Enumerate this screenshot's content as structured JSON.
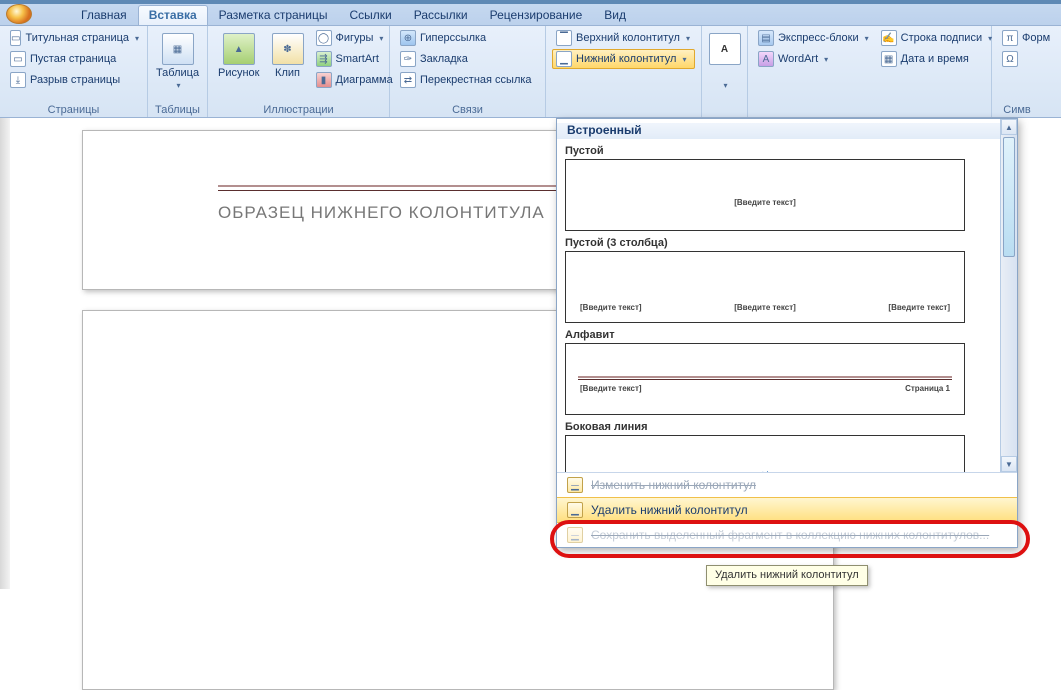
{
  "tabs": {
    "home": "Главная",
    "insert": "Вставка",
    "layout": "Разметка страницы",
    "refs": "Ссылки",
    "mail": "Рассылки",
    "review": "Рецензирование",
    "view": "Вид"
  },
  "ribbon": {
    "pages": {
      "title": "Страницы",
      "cover": "Титульная страница",
      "blank": "Пустая страница",
      "break": "Разрыв страницы"
    },
    "tables": {
      "title": "Таблицы",
      "table": "Таблица"
    },
    "illus": {
      "title": "Иллюстрации",
      "pic": "Рисунок",
      "clip": "Клип",
      "shapes": "Фигуры",
      "smart": "SmartArt",
      "chart": "Диаграмма"
    },
    "links": {
      "title": "Связи",
      "hyper": "Гиперссылка",
      "book": "Закладка",
      "cross": "Перекрестная ссылка"
    },
    "hf": {
      "header": "Верхний колонтитул",
      "footer": "Нижний колонтитул"
    },
    "text": {
      "blocks": "Экспресс-блоки",
      "wordart": "WordArt",
      "sig": "Строка подписи",
      "date": "Дата и время"
    },
    "sym": {
      "title": "Симв",
      "formula": "Форм"
    }
  },
  "doc": {
    "sample_title": "ОБРАЗЕЦ НИЖНЕГО КОЛОНТИТУЛА"
  },
  "gallery": {
    "header": "Встроенный",
    "empty": "Пустой",
    "empty3": "Пустой (3 столбца)",
    "alpha": "Алфавит",
    "side": "Боковая линия",
    "ph": "[Введите текст]",
    "page1": "Страница 1",
    "edit": "Изменить нижний колонтитул",
    "remove": "Удалить нижний колонтитул",
    "save_sel": "Сохранить выделенный фрагмент в коллекцию нижних колонтитулов..."
  },
  "tooltip": "Удалить нижний колонтитул"
}
